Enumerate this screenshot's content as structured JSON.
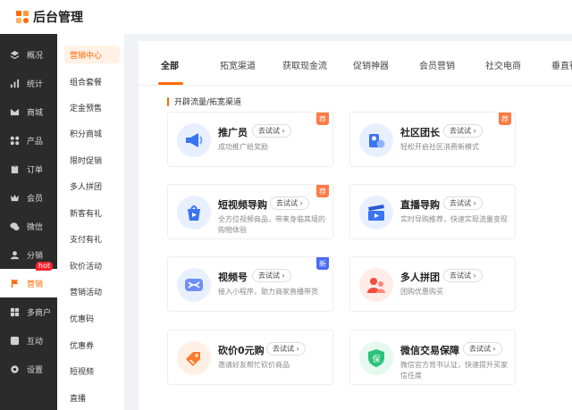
{
  "app": {
    "title": "后台管理"
  },
  "sidebar": {
    "items": [
      {
        "label": "概况",
        "icon": "layers-icon"
      },
      {
        "label": "统计",
        "icon": "chart-icon"
      },
      {
        "label": "商城",
        "icon": "mail-icon"
      },
      {
        "label": "产品",
        "icon": "grid-icon"
      },
      {
        "label": "订单",
        "icon": "clipboard-icon"
      },
      {
        "label": "会员",
        "icon": "crown-icon"
      },
      {
        "label": "微信",
        "icon": "wechat-icon"
      },
      {
        "label": "分销",
        "icon": "user-icon"
      },
      {
        "label": "营销",
        "icon": "flag-icon",
        "badge": "hot"
      },
      {
        "label": "多商户",
        "icon": "store-icon"
      },
      {
        "label": "互动",
        "icon": "interact-icon"
      },
      {
        "label": "设置",
        "icon": "gear-icon"
      }
    ]
  },
  "subnav": {
    "items": [
      "营销中心",
      "组合套餐",
      "定金预售",
      "积分商城",
      "限时促销",
      "多人拼团",
      "新客有礼",
      "支付有礼",
      "砍价活动",
      "营销活动",
      "优惠码",
      "优惠券",
      "短视频",
      "直播"
    ]
  },
  "tabs": [
    "全部",
    "拓宽渠道",
    "获取现金流",
    "促销神器",
    "会员营销",
    "社交电商",
    "垂直行"
  ],
  "section": {
    "title": "开辟流量/拓宽渠道"
  },
  "try_label": "去试试",
  "cards": [
    {
      "title": "推广员",
      "desc": "成功推广给奖励",
      "badge": "荐",
      "icon": "megaphone-icon"
    },
    {
      "title": "社区团长",
      "desc": "轻松开启社区消费新模式",
      "badge": "荐",
      "icon": "community-leader-icon"
    },
    {
      "title": "短视频导购",
      "desc": "全方位视频商品，带来身临其境的购物体验",
      "badge": "荐",
      "icon": "video-bag-icon"
    },
    {
      "title": "直播导购",
      "desc": "实时导购推荐，快速实现流量变现",
      "badge": "",
      "icon": "clapper-icon"
    },
    {
      "title": "视频号",
      "desc": "接入小程序，助力商家直播带货",
      "badge": "新",
      "icon": "channels-icon"
    },
    {
      "title": "多人拼团",
      "desc": "团购优惠购买",
      "badge": "",
      "icon": "group-icon"
    },
    {
      "title": "砍价0元购",
      "desc": "邀请好友帮忙砍价商品",
      "badge": "",
      "icon": "price-tag-icon"
    },
    {
      "title": "微信交易保障",
      "desc": "微信官方背书认证，快速提升买家信任度",
      "badge": "",
      "icon": "shield-icon",
      "icon_text": "保"
    }
  ],
  "colors": {
    "accent": "#ff6a00",
    "sidebar_bg": "#2b2b2b",
    "badge_orange": "#ff7a45",
    "badge_blue": "#4a6cf7"
  }
}
